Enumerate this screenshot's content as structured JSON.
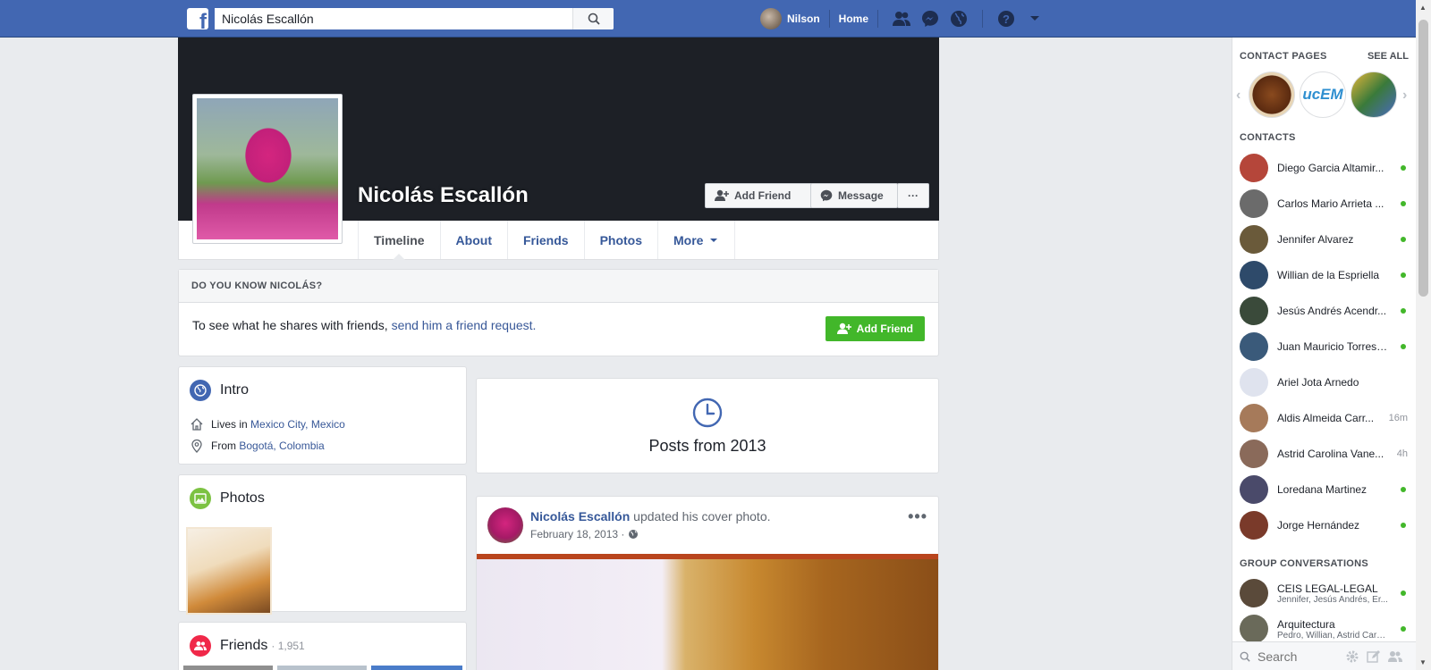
{
  "search": {
    "value": "Nicolás Escallón"
  },
  "nav": {
    "user": "Nilson",
    "home": "Home"
  },
  "profile": {
    "name": "Nicolás Escallón",
    "add_friend": "Add Friend",
    "message": "Message",
    "more_dots": "···"
  },
  "tabs": [
    {
      "label": "Timeline"
    },
    {
      "label": "About"
    },
    {
      "label": "Friends"
    },
    {
      "label": "Photos"
    },
    {
      "label": "More"
    }
  ],
  "know": {
    "heading": "DO YOU KNOW NICOLÁS?",
    "text": "To see what he shares with friends,",
    "link": "send him a friend request.",
    "button": "Add Friend"
  },
  "intro": {
    "title": "Intro",
    "lives_prefix": "Lives in",
    "lives_place": "Mexico City, Mexico",
    "from_prefix": "From",
    "from_place": "Bogotá, Colombia"
  },
  "photos": {
    "title": "Photos"
  },
  "friends": {
    "title": "Friends",
    "count": "· 1,951"
  },
  "posts_from": {
    "label": "Posts from 2013"
  },
  "post": {
    "author": "Nicolás Escallón",
    "action": "updated his cover photo.",
    "date": "February 18, 2013 ·",
    "more": "•••"
  },
  "sidebar": {
    "contact_pages_label": "CONTACT PAGES",
    "see_all": "SEE ALL",
    "page2_text": "ucEM",
    "contacts_label": "CONTACTS",
    "contacts": [
      {
        "name": "Diego Garcia Altamir...",
        "status": "",
        "color": "#b5463a"
      },
      {
        "name": "Carlos Mario Arrieta ...",
        "status": "",
        "color": "#6b6b6b"
      },
      {
        "name": "Jennifer Alvarez",
        "status": "",
        "color": "#6a5a3a"
      },
      {
        "name": "Willian de la Espriella",
        "status": "",
        "color": "#2e4a6a"
      },
      {
        "name": "Jesús Andrés Acendr...",
        "status": "",
        "color": "#3a4a3a"
      },
      {
        "name": "Juan Mauricio Torres ...",
        "status": "",
        "color": "#3a5a7a"
      },
      {
        "name": "Ariel Jota Arnedo",
        "status": "",
        "color": "#dfe3ee"
      },
      {
        "name": "Aldis Almeida Carr...",
        "status": "16m",
        "color": "#a67a5a"
      },
      {
        "name": "Astrid Carolina Vane...",
        "status": "4h",
        "color": "#8a6a5a"
      },
      {
        "name": "Loredana Martinez",
        "status": "",
        "color": "#4a4a6a"
      },
      {
        "name": "Jorge Hernández",
        "status": "",
        "color": "#7a3a2a"
      }
    ],
    "group_label": "GROUP CONVERSATIONS",
    "groups": [
      {
        "name": "CEIS LEGAL-LEGAL",
        "members": "Jennifer, Jesús Andrés, Er..."
      },
      {
        "name": "Arquitectura",
        "members": "Pedro, Willian, Astrid Caro..."
      }
    ],
    "search_placeholder": "Search"
  },
  "colors": {
    "brand": "#4267b2",
    "link": "#365899",
    "online": "#42b72a"
  }
}
